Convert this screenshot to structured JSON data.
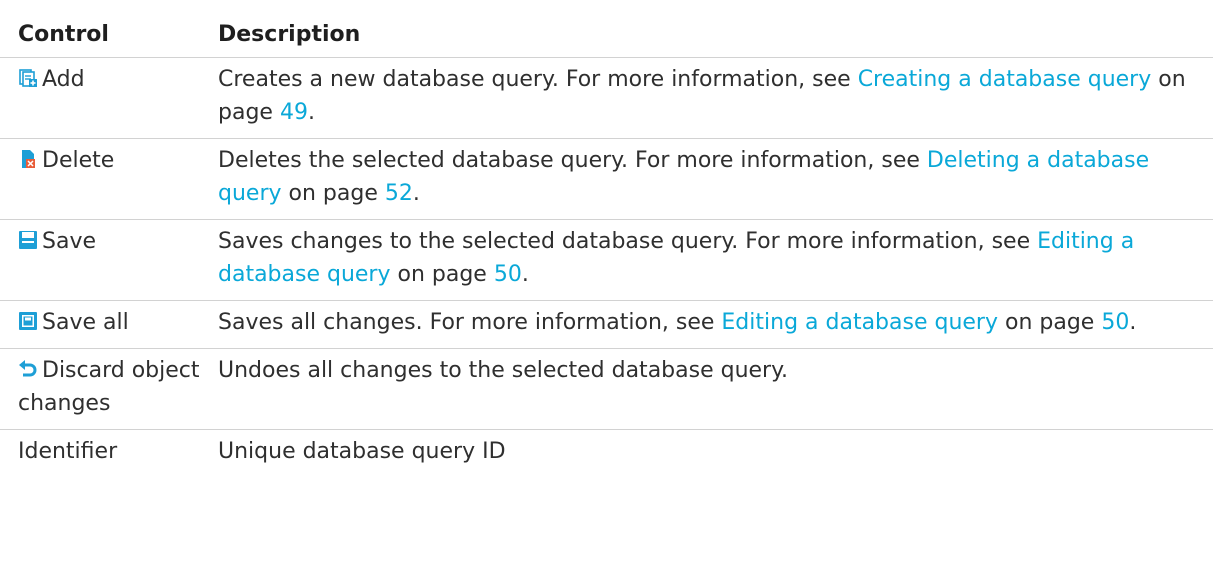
{
  "table": {
    "headers": {
      "control": "Control",
      "description": "Description"
    },
    "rows": [
      {
        "icon": "add-document-icon",
        "control": "Add",
        "desc_before": "Creates a new database query. For more information, see ",
        "link": "Creating a database query",
        "desc_mid": " on page ",
        "page": "49",
        "desc_after": "."
      },
      {
        "icon": "delete-document-icon",
        "control": "Delete",
        "desc_before": "Deletes the selected database query. For more information, see ",
        "link": "Deleting a database query",
        "desc_mid": " on page ",
        "page": "52",
        "desc_after": "."
      },
      {
        "icon": "save-icon",
        "control": "Save",
        "desc_before": "Saves changes to the selected database query. For more information, see ",
        "link": "Editing a database query",
        "desc_mid": " on page ",
        "page": "50",
        "desc_after": "."
      },
      {
        "icon": "save-all-icon",
        "control": "Save all",
        "desc_before": "Saves all changes. For more information, see ",
        "link": "Editing a database query",
        "desc_mid": " on page ",
        "page": "50",
        "desc_after": "."
      },
      {
        "icon": "undo-icon",
        "control": "Discard object changes",
        "desc": "Undoes all changes to the selected database query."
      },
      {
        "control": "Identifier",
        "desc": "Unique database query ID"
      }
    ]
  },
  "colors": {
    "link": "#0aa8d8",
    "icon_blue": "#1e9fd6",
    "icon_red": "#e04040"
  }
}
